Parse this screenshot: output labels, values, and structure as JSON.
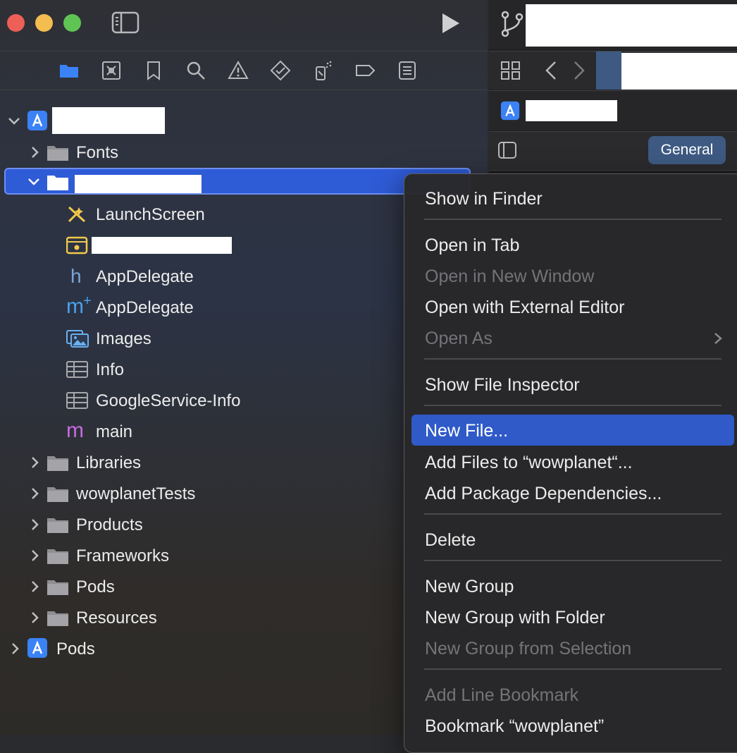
{
  "navigator": {
    "tree": {
      "project_label": "",
      "fonts_label": "Fonts",
      "group_label": "",
      "launchscreen_label": "LaunchScreen",
      "hidden_file_label": "",
      "appdelegate_h_label": "AppDelegate",
      "appdelegate_m_label": "AppDelegate",
      "images_label": "Images",
      "info_label": "Info",
      "googleservice_label": "GoogleService-Info",
      "main_label": "main",
      "libraries_label": "Libraries",
      "tests_label": "wowplanetTests",
      "products_label": "Products",
      "frameworks_label": "Frameworks",
      "pods_folder_label": "Pods",
      "resources_label": "Resources",
      "pods_project_label": "Pods"
    },
    "glyphs": {
      "h_file": "h",
      "m_file": "m",
      "m_plus": "+"
    }
  },
  "editor": {
    "general_tab": "General"
  },
  "context_menu": {
    "items": [
      {
        "label": "Show in Finder",
        "enabled": true
      },
      {
        "label": "Open in Tab",
        "enabled": true
      },
      {
        "label": "Open in New Window",
        "enabled": false
      },
      {
        "label": "Open with External Editor",
        "enabled": true
      },
      {
        "label": "Open As",
        "enabled": false
      },
      {
        "label": "Show File Inspector",
        "enabled": true
      },
      {
        "label": "New File...",
        "enabled": true,
        "highlighted": true
      },
      {
        "label": "Add Files to “wowplanet“...",
        "enabled": true
      },
      {
        "label": "Add Package Dependencies...",
        "enabled": true
      },
      {
        "label": "Delete",
        "enabled": true
      },
      {
        "label": "New Group",
        "enabled": true
      },
      {
        "label": "New Group with Folder",
        "enabled": true
      },
      {
        "label": "New Group from Selection",
        "enabled": false
      },
      {
        "label": "Add Line Bookmark",
        "enabled": false
      },
      {
        "label": "Bookmark “wowplanet”",
        "enabled": true
      }
    ]
  },
  "colors": {
    "selection": "#2e5bd6",
    "menu_highlight": "#2f5ac8",
    "close": "#ed5f57",
    "minimize": "#f4bd4f",
    "maximize": "#5fc454"
  }
}
